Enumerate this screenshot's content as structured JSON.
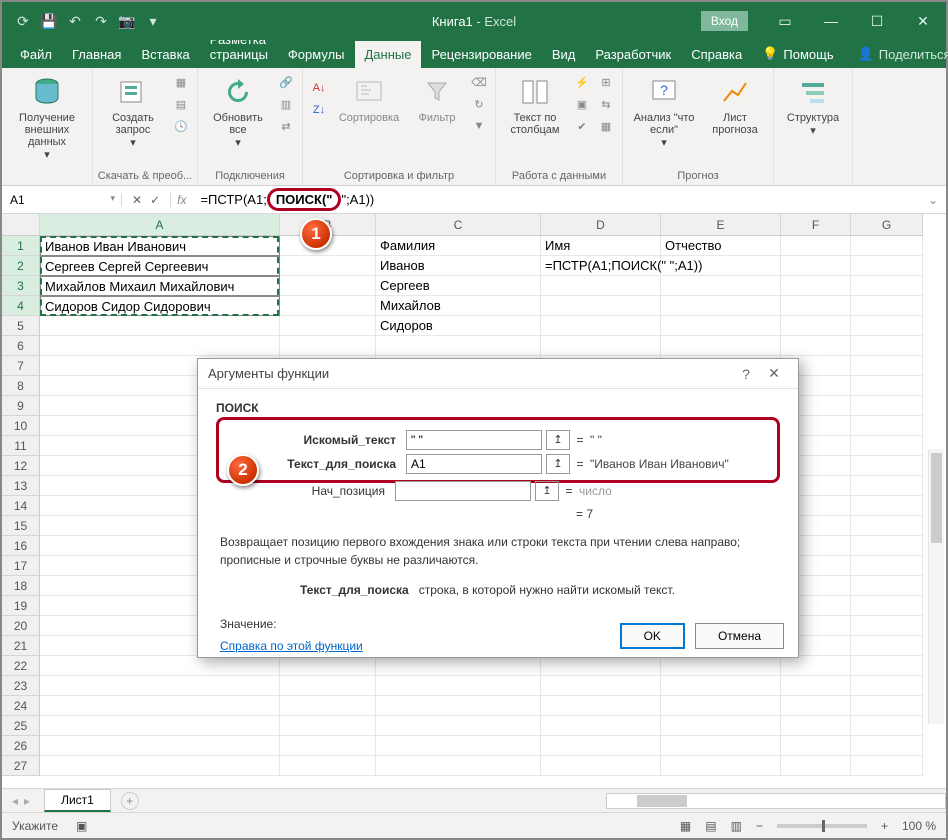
{
  "title": {
    "doc": "Книга1",
    "app": "Excel"
  },
  "login_btn": "Вход",
  "tabs": [
    "Файл",
    "Главная",
    "Вставка",
    "Разметка страницы",
    "Формулы",
    "Данные",
    "Рецензирование",
    "Вид",
    "Разработчик",
    "Справка"
  ],
  "active_tab": "Данные",
  "tell_me": "Помощь",
  "share": "Поделиться",
  "ribbon": {
    "g1": {
      "btn": "Получение внешних данных",
      "label": ""
    },
    "g2": {
      "btn": "Создать запрос",
      "label": "Скачать & преоб..."
    },
    "g3": {
      "btn": "Обновить все",
      "label": "Подключения"
    },
    "g4": {
      "sort": "Сортировка",
      "filter": "Фильтр",
      "label": "Сортировка и фильтр"
    },
    "g5": {
      "btn": "Текст по столбцам",
      "label": "Работа с данными"
    },
    "g6": {
      "what": "Анализ \"что если\"",
      "forecast": "Лист прогноза",
      "label": "Прогноз"
    },
    "g7": {
      "btn": "Структура"
    }
  },
  "namebox": "A1",
  "formula": {
    "pre": "=ПСТР(A1;",
    "hl": "ПОИСК(\"",
    "post": "\";A1))"
  },
  "cols": [
    "A",
    "B",
    "C",
    "D",
    "E",
    "F",
    "G"
  ],
  "rows_count": 27,
  "cells": {
    "A1": "Иванов Иван Иванович",
    "A2": "Сергеев Сергей Сергеевич",
    "A3": "Михайлов Михаил Михайлович",
    "A4": "Сидоров Сидор Сидорович",
    "C1": "Фамилия",
    "D1": "Имя",
    "E1": "Отчество",
    "C2": "Иванов",
    "D2": "=ПСТР(A1;ПОИСК(\" \";A1))",
    "C3": "Сергеев",
    "C4": "Михайлов",
    "C5": "Сидоров"
  },
  "dialog": {
    "title": "Аргументы функции",
    "func": "ПОИСК",
    "args": {
      "a1": {
        "label": "Искомый_текст",
        "value": "\" \"",
        "result": "\" \""
      },
      "a2": {
        "label": "Текст_для_поиска",
        "value": "A1",
        "result": "\"Иванов Иван Иванович\""
      },
      "a3": {
        "label": "Нач_позиция",
        "value": "",
        "result": "число"
      }
    },
    "calc": "=  7",
    "desc": "Возвращает позицию первого вхождения знака или строки текста при чтении слева направо; прописные и строчные буквы не различаются.",
    "arg_desc_label": "Текст_для_поиска",
    "arg_desc": "строка, в которой нужно найти искомый текст.",
    "value_label": "Значение:",
    "help": "Справка по этой функции",
    "ok": "OK",
    "cancel": "Отмена"
  },
  "sheet_tab": "Лист1",
  "status": "Укажите",
  "zoom": "100 %"
}
